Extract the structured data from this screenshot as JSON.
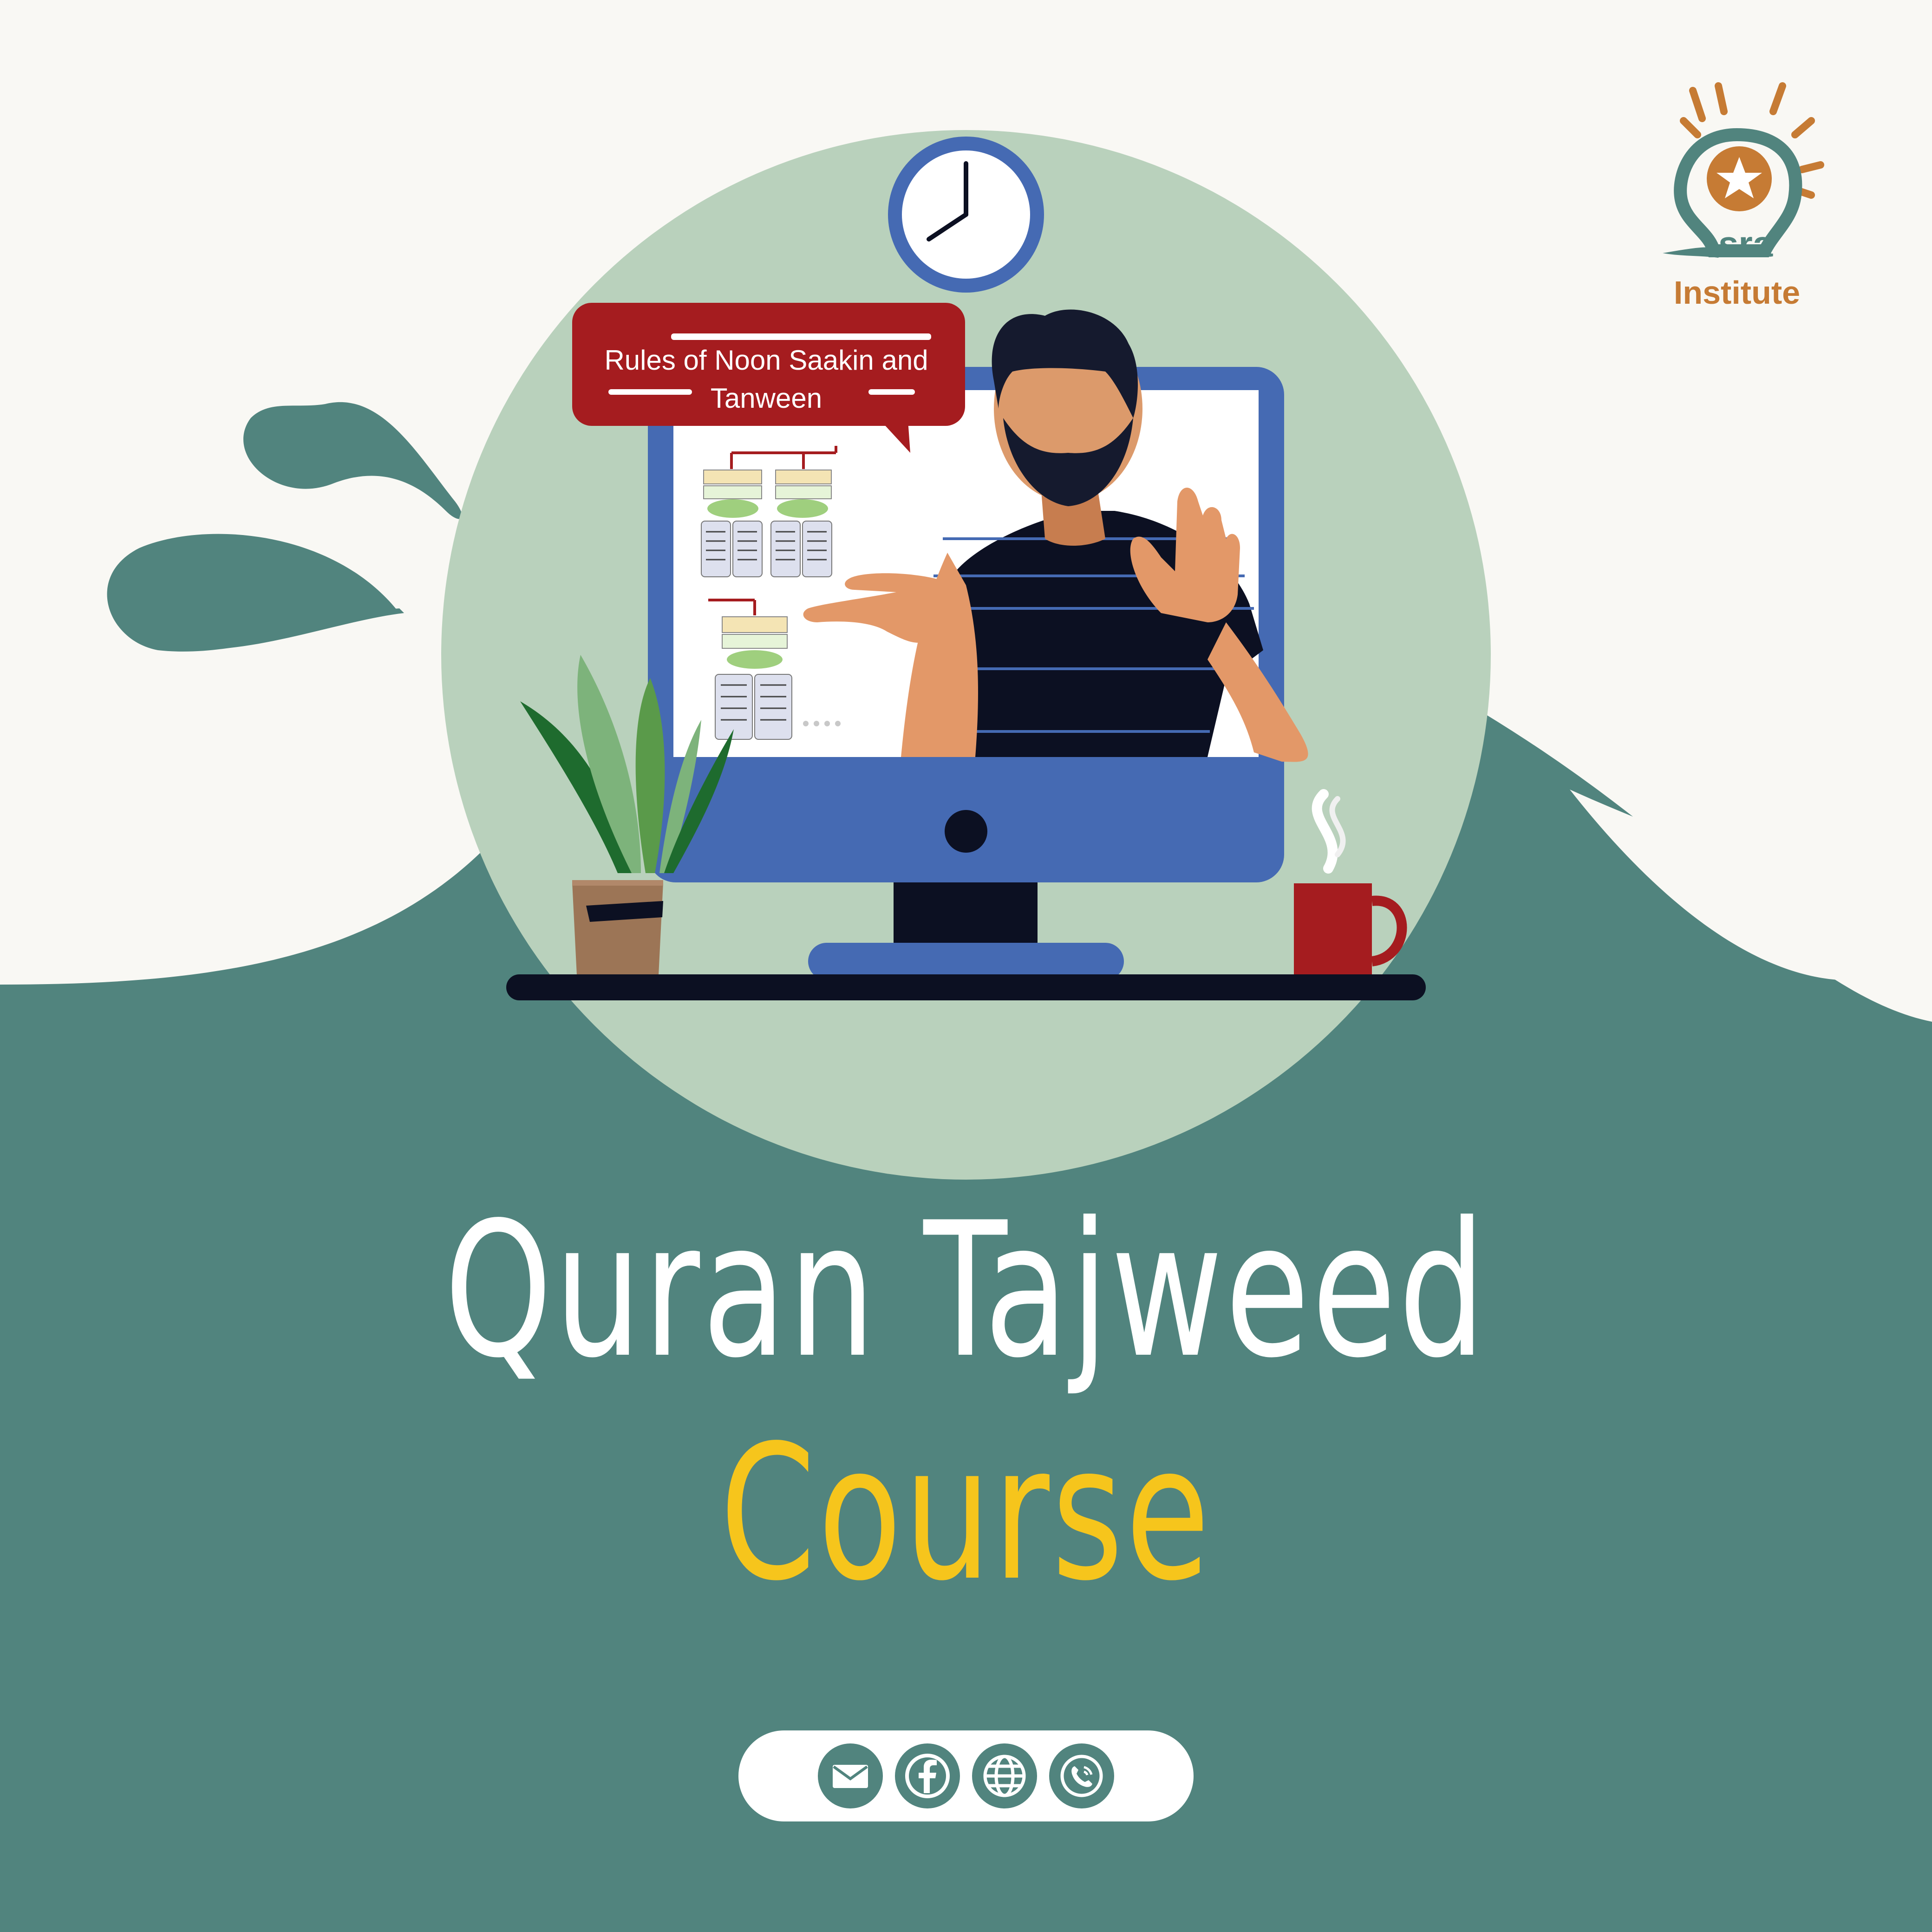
{
  "colors": {
    "background": "#f9f8f4",
    "teal": "#51847e",
    "sage": "#b9d1bc",
    "accent_red": "#a51c1f",
    "accent_yellow": "#f6c51c",
    "logo_orange": "#c67b34",
    "monitor_blue": "#456ab3",
    "navy": "#0c1022"
  },
  "logo": {
    "word_sra": "sra",
    "word_institute": "Institute",
    "icon": "lightbulb-logo-icon"
  },
  "speech_bubble": {
    "text": "Rules of Noon Saakin and Tanween"
  },
  "title": {
    "line1": "Quran Tajweed",
    "line2": "Course"
  },
  "contact_bar": {
    "icons": [
      "email-icon",
      "facebook-icon",
      "globe-icon",
      "phone-icon"
    ]
  }
}
